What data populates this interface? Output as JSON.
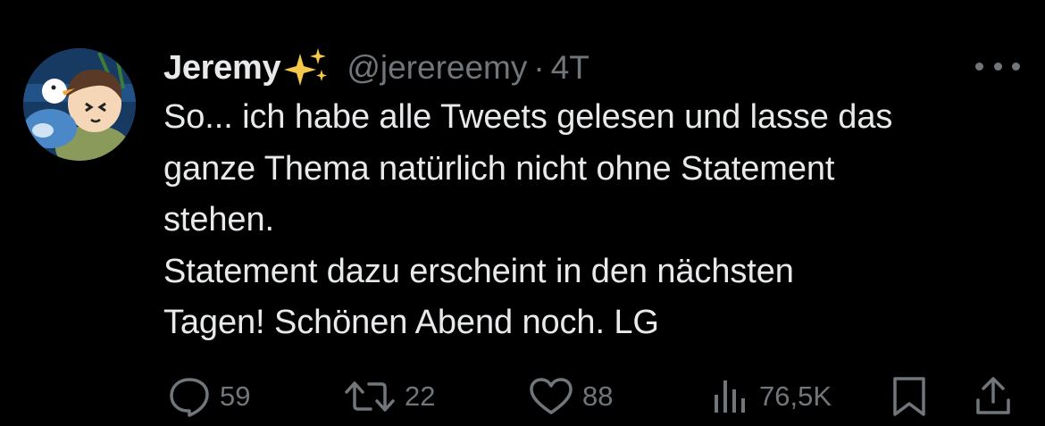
{
  "author": {
    "display_name": "Jeremy",
    "emoji": "sparkles",
    "handle": "@jerereemy",
    "separator": "·",
    "time": "4T"
  },
  "tweet_lines": [
    "So... ich habe alle Tweets gelesen und lasse das",
    "ganze Thema natürlich nicht ohne Statement",
    "stehen.",
    "Statement dazu erscheint in den nächsten",
    "Tagen! Schönen Abend noch. LG"
  ],
  "actions": {
    "replies": "59",
    "retweets": "22",
    "likes": "88",
    "views": "76,5K"
  },
  "icons": {
    "reply": "speech-bubble-icon",
    "retweet": "retweet-arrows-icon",
    "like": "heart-icon",
    "views": "bar-chart-icon",
    "bookmark": "bookmark-icon",
    "share": "share-upload-icon",
    "more": "more-dots-icon"
  },
  "colors": {
    "background": "#000000",
    "text": "#e7e9ea",
    "muted": "#71767b",
    "sparkle": "#f7c948"
  }
}
